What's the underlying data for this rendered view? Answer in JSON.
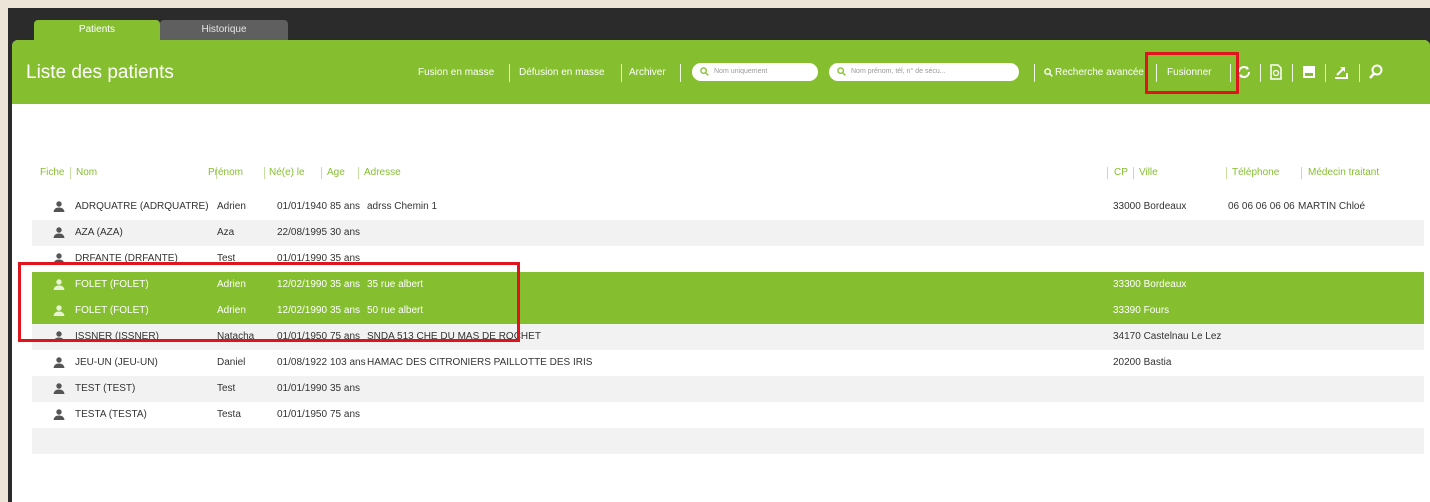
{
  "tabs": [
    {
      "label": "Patients",
      "active": true
    },
    {
      "label": "Historique",
      "active": false
    }
  ],
  "header": {
    "title": "Liste des patients",
    "actions": {
      "fusion_masse": "Fusion en masse",
      "defusion_masse": "Défusion en masse",
      "archiver": "Archiver",
      "recherche_avancee": "Recherche avancée",
      "fusionner": "Fusionner"
    },
    "search_name_placeholder": "Nom uniquement",
    "search_full_placeholder": "Nom prénom, tél, n° de sécu..."
  },
  "icons": [
    "sync-icon",
    "document-icon",
    "print-icon",
    "export-icon",
    "search-settings-icon",
    "person-icon",
    "search-icon"
  ],
  "colors": {
    "accent": "#85bf2f",
    "highlight": "#e0141e",
    "frame": "#2b2b2b"
  },
  "table": {
    "columns": {
      "fiche": "Fiche",
      "nom": "Nom",
      "prenom": "Prénom",
      "ne_le": "Né(e) le",
      "age": "Age",
      "adresse": "Adresse",
      "cp": "CP",
      "ville": "Ville",
      "telephone": "Téléphone",
      "medecin": "Médecin traitant"
    },
    "rows": [
      {
        "nom": "ADRQUATRE (ADRQUATRE)",
        "prenom": "Adrien",
        "ne_le": "01/01/1940",
        "age": "85 ans",
        "adresse": "adrss Chemin 1",
        "cp_ville": "33000 Bordeaux",
        "telephone": "06 06 06 06 06",
        "medecin": "MARTIN Chloé",
        "selected": false
      },
      {
        "nom": "AZA (AZA)",
        "prenom": "Aza",
        "ne_le": "22/08/1995",
        "age": "30 ans",
        "adresse": "",
        "cp_ville": "",
        "telephone": "",
        "medecin": "",
        "selected": false
      },
      {
        "nom": "DRFANTE (DRFANTE)",
        "prenom": "Test",
        "ne_le": "01/01/1990",
        "age": "35 ans",
        "adresse": "",
        "cp_ville": "",
        "telephone": "",
        "medecin": "",
        "selected": false
      },
      {
        "nom": "FOLET (FOLET)",
        "prenom": "Adrien",
        "ne_le": "12/02/1990",
        "age": "35 ans",
        "adresse": "35 rue albert",
        "cp_ville": "33300 Bordeaux",
        "telephone": "",
        "medecin": "",
        "selected": true
      },
      {
        "nom": "FOLET (FOLET)",
        "prenom": "Adrien",
        "ne_le": "12/02/1990",
        "age": "35 ans",
        "adresse": "50 rue albert",
        "cp_ville": "33390 Fours",
        "telephone": "",
        "medecin": "",
        "selected": true
      },
      {
        "nom": "ISSNER (ISSNER)",
        "prenom": "Natacha",
        "ne_le": "01/01/1950",
        "age": "75 ans",
        "adresse": "SNDA 513 CHE DU MAS DE ROCHET",
        "cp_ville": "34170 Castelnau Le Lez",
        "telephone": "",
        "medecin": "",
        "selected": false
      },
      {
        "nom": "JEU-UN (JEU-UN)",
        "prenom": "Daniel",
        "ne_le": "01/08/1922",
        "age": "103 ans",
        "adresse": "HAMAC DES CITRONIERS PAILLOTTE DES IRIS",
        "cp_ville": "20200 Bastia",
        "telephone": "",
        "medecin": "",
        "selected": false
      },
      {
        "nom": "TEST (TEST)",
        "prenom": "Test",
        "ne_le": "01/01/1990",
        "age": "35 ans",
        "adresse": "",
        "cp_ville": "",
        "telephone": "",
        "medecin": "",
        "selected": false
      },
      {
        "nom": "TESTA (TESTA)",
        "prenom": "Testa",
        "ne_le": "01/01/1950",
        "age": "75 ans",
        "adresse": "",
        "cp_ville": "",
        "telephone": "",
        "medecin": "",
        "selected": false
      }
    ]
  }
}
